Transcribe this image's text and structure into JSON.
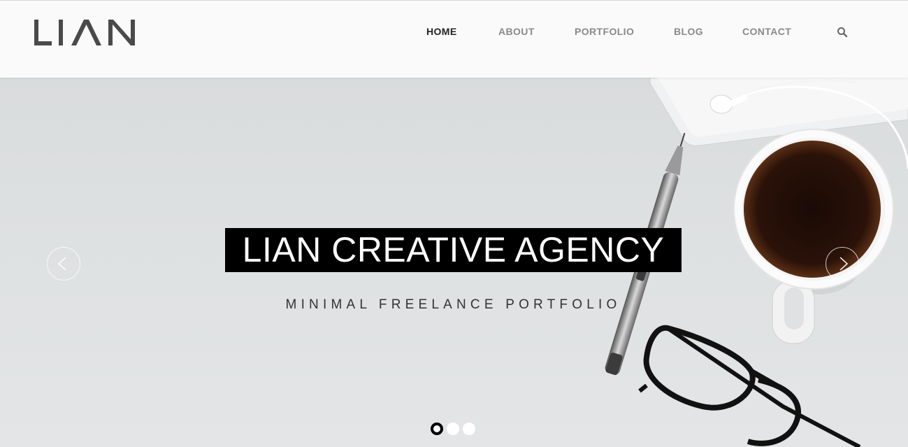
{
  "brand": {
    "logo_text": "LIAN"
  },
  "nav": {
    "items": [
      {
        "label": "HOME",
        "active": true
      },
      {
        "label": "ABOUT",
        "active": false
      },
      {
        "label": "PORTFOLIO",
        "active": false
      },
      {
        "label": "BLOG",
        "active": false
      },
      {
        "label": "CONTACT",
        "active": false
      }
    ],
    "search_icon": "search-icon"
  },
  "hero": {
    "title": "LIAN CREATIVE AGENCY",
    "subtitle": "MINIMAL FREELANCE PORTFOLIO",
    "prev_icon": "chevron-left-icon",
    "next_icon": "chevron-right-icon",
    "slides": 3,
    "active_slide": 1
  },
  "colors": {
    "header_bg": "#fafafa",
    "nav_active": "#222222",
    "nav_inactive": "#8a8a8a",
    "title_bg": "#000000",
    "title_text": "#ffffff",
    "logo": "#4a4a4a"
  }
}
